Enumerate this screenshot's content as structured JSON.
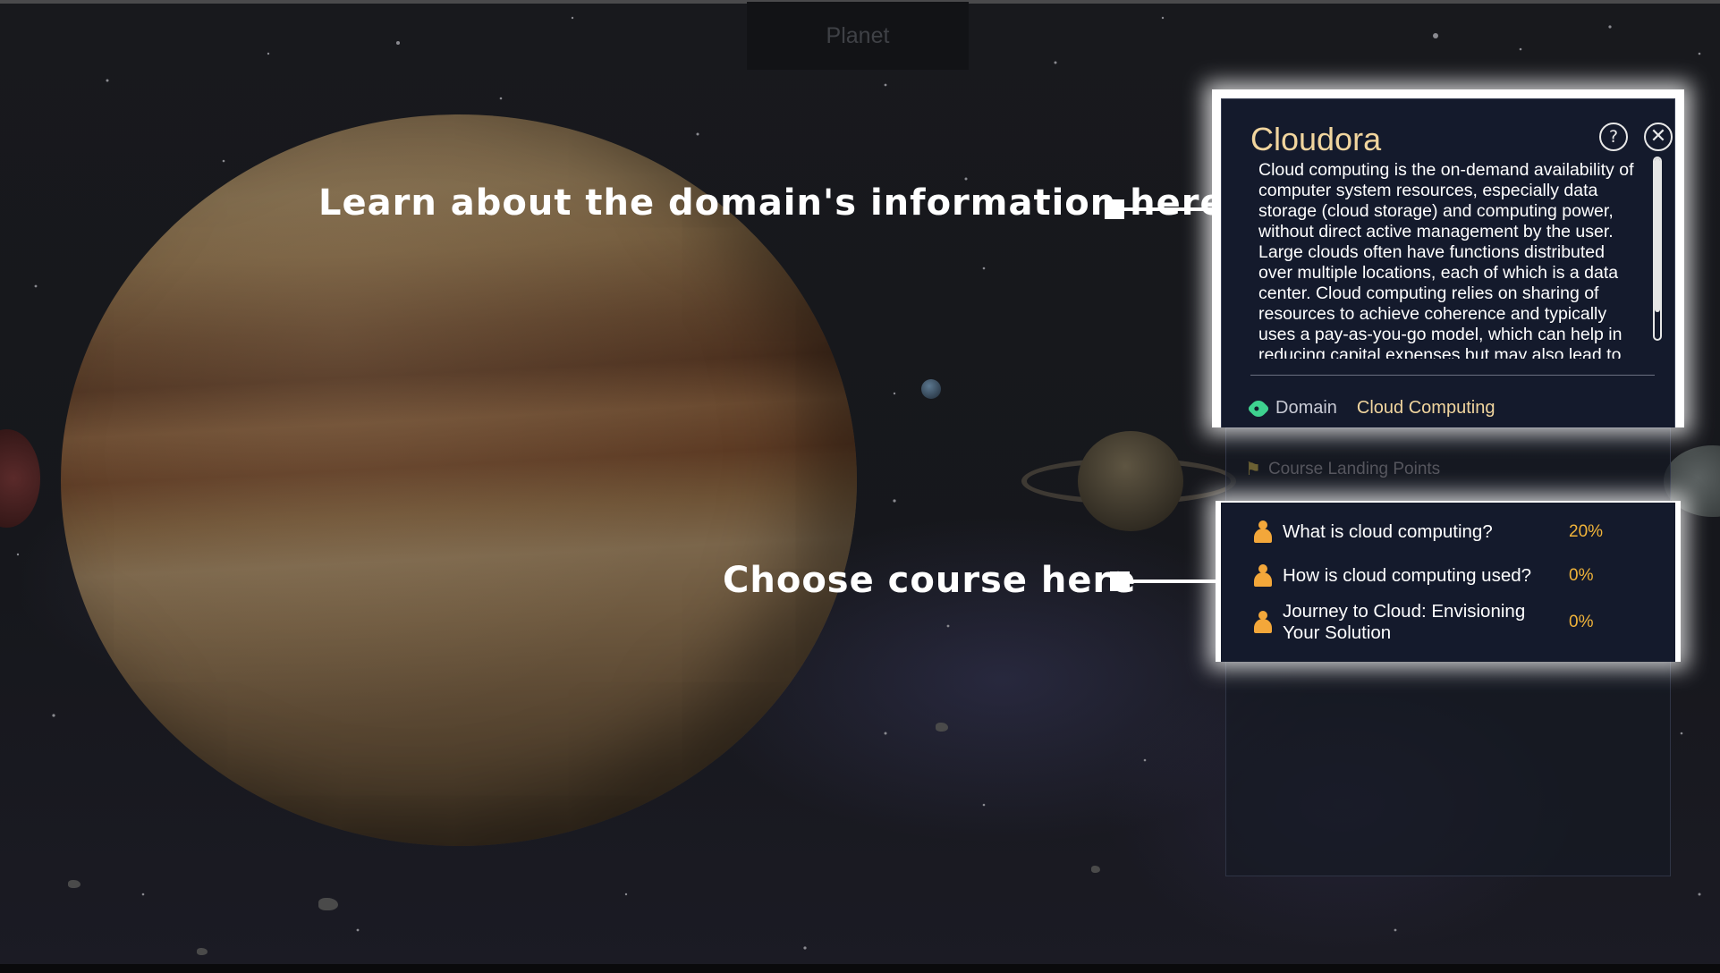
{
  "header": {
    "tab_label": "Planet"
  },
  "annotations": {
    "domain_info": "Learn about the domain's information here",
    "choose_course": "Choose course here"
  },
  "info_panel": {
    "title": "Cloudora",
    "help_icon": "help-circle-icon",
    "close_icon": "close-circle-icon",
    "description": "Cloud computing is the on-demand availability of computer system resources, especially data storage (cloud storage) and computing power, without direct active management by the user. Large clouds often have functions distributed over multiple locations, each of which is a data center. Cloud computing relies on sharing of resources to achieve coherence and typically uses a pay-as-you-go model, which can help in reducing capital expenses but may also lead to",
    "domain_label": "Domain",
    "domain_value": "Cloud Computing"
  },
  "landing_points": {
    "label": "Course Landing Points"
  },
  "courses": [
    {
      "name": "What is cloud computing?",
      "progress": "20%"
    },
    {
      "name": "How is cloud computing used?",
      "progress": "0%"
    },
    {
      "name": "Journey to Cloud: Envisioning Your Solution",
      "progress": "0%"
    }
  ],
  "colors": {
    "title_gold": "#f1d59e",
    "progress_orange": "#f1b43a",
    "tag_green": "#3ed28f",
    "panel_bg": "#141a2c"
  }
}
